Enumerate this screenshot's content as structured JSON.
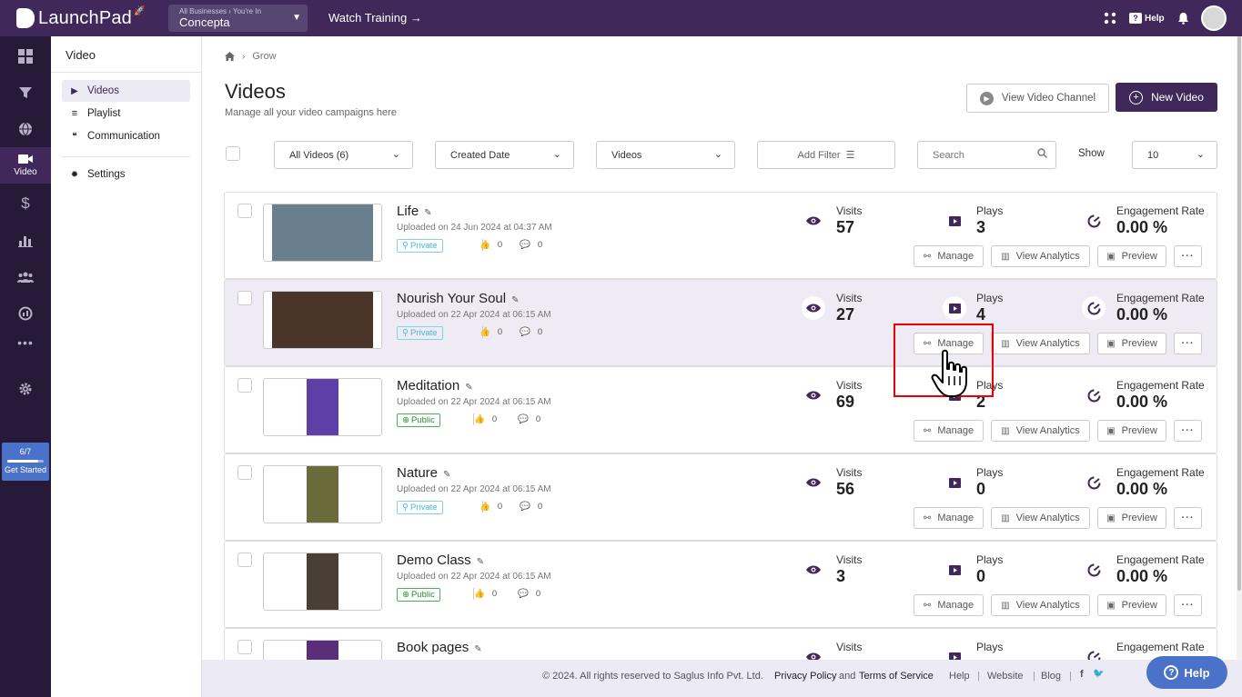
{
  "topbar": {
    "logo_text": "LaunchPad",
    "business_crumb": "All Businesses › You're In",
    "business_name": "Concepta",
    "watch_training": "Watch Training →",
    "help_label": "Help"
  },
  "leftnav": {
    "video_label": "Video",
    "get_started_progress": "6/7",
    "get_started_fraction": 0.857,
    "get_started_label": "Get Started"
  },
  "subnav": {
    "title": "Video",
    "items": [
      {
        "label": "Videos"
      },
      {
        "label": "Playlist"
      },
      {
        "label": "Communication"
      }
    ],
    "settings_label": "Settings"
  },
  "breadcrumb": {
    "item": "Grow"
  },
  "page": {
    "title": "Videos",
    "subtitle": "Manage all your video campaigns here",
    "view_channel_label": "View Video Channel",
    "new_video_label": "New Video"
  },
  "filters": {
    "all_videos": "All Videos (6)",
    "created_date": "Created Date",
    "videos": "Videos",
    "add_filter": "Add Filter",
    "search_placeholder": "Search",
    "show_label": "Show",
    "show_value": "10"
  },
  "labels": {
    "visits": "Visits",
    "plays": "Plays",
    "engagement": "Engagement Rate",
    "manage": "Manage",
    "view_analytics": "View Analytics",
    "preview": "Preview"
  },
  "videos": [
    {
      "title": "Life",
      "uploaded": "Uploaded on 24 Jun 2024 at 04:37 AM",
      "visibility": "Private",
      "likes": "0",
      "comments": "0",
      "visits": "57",
      "plays": "3",
      "engagement": "0.00 %",
      "thumb_color": "#6a7f8e"
    },
    {
      "title": "Nourish Your Soul",
      "uploaded": "Uploaded on 22 Apr 2024 at 06:15 AM",
      "visibility": "Private",
      "likes": "0",
      "comments": "0",
      "visits": "27",
      "plays": "4",
      "engagement": "0.00 %",
      "thumb_color": "#4a3528"
    },
    {
      "title": "Meditation",
      "uploaded": "Uploaded on 22 Apr 2024 at 06:15 AM",
      "visibility": "Public",
      "likes": "0",
      "comments": "0",
      "visits": "69",
      "plays": "2",
      "engagement": "0.00 %",
      "thumb_color": "#5d3fa8"
    },
    {
      "title": "Nature",
      "uploaded": "Uploaded on 22 Apr 2024 at 06:15 AM",
      "visibility": "Private",
      "likes": "0",
      "comments": "0",
      "visits": "56",
      "plays": "0",
      "engagement": "0.00 %",
      "thumb_color": "#6b6a3a"
    },
    {
      "title": "Demo Class",
      "uploaded": "Uploaded on 22 Apr 2024 at 06:15 AM",
      "visibility": "Public",
      "likes": "0",
      "comments": "0",
      "visits": "3",
      "plays": "0",
      "engagement": "0.00 %",
      "thumb_color": "#4a3f36"
    },
    {
      "title": "Book pages",
      "uploaded": "",
      "visibility": "",
      "likes": "",
      "comments": "",
      "visits": "",
      "plays": "",
      "engagement": "",
      "thumb_color": "#5b2e7a"
    }
  ],
  "footer": {
    "copyright": "© 2024. All rights reserved to Saglus Info Pvt. Ltd.",
    "privacy": "Privacy Policy",
    "and": "and",
    "terms": "Terms of Service",
    "help": "Help",
    "website": "Website",
    "blog": "Blog",
    "sep": "|"
  },
  "help_button": {
    "label": "Help"
  },
  "colors": {
    "brand": "#40285a",
    "accent": "#4a72c8",
    "highlight": "#eeebf5"
  }
}
